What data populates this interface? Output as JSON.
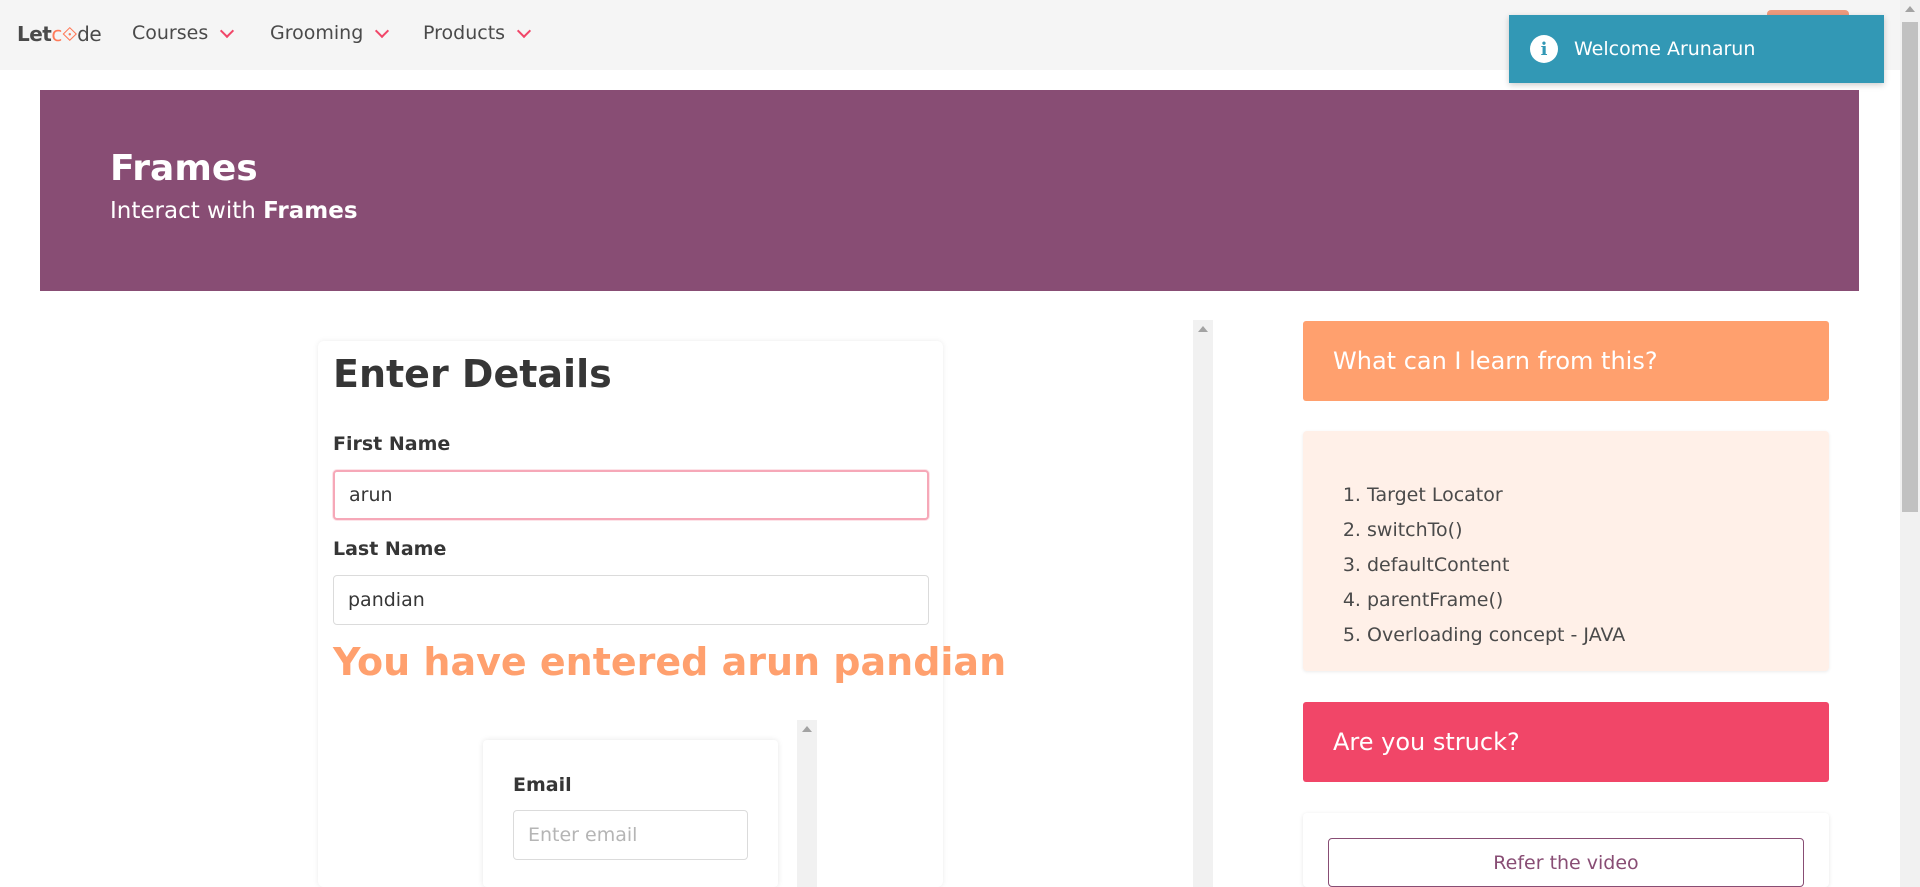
{
  "navbar": {
    "logo": {
      "part1": "Let",
      "part2": "c",
      "part3": "de"
    },
    "items": [
      {
        "label": "Courses"
      },
      {
        "label": "Grooming"
      },
      {
        "label": "Products"
      }
    ]
  },
  "toast": {
    "message": "Welcome Arunarun"
  },
  "hero": {
    "title": "Frames",
    "subtitle_prefix": "Interact with ",
    "subtitle_bold": "Frames"
  },
  "frame": {
    "heading": "Enter Details",
    "first_name_label": "First Name",
    "first_name_value": "arun",
    "last_name_label": "Last Name",
    "last_name_value": "pandian",
    "entered_text": "You have entered arun pandian",
    "inner": {
      "email_label": "Email",
      "email_placeholder": "Enter email"
    }
  },
  "sidebar": {
    "learn_title": "What can I learn from this?",
    "learn_items": [
      "Target Locator",
      "switchTo()",
      "defaultContent",
      "parentFrame()",
      "Overloading concept - JAVA"
    ],
    "struck_title": "Are you struck?",
    "video_button": "Refer the video"
  },
  "colors": {
    "hero": "#884d74",
    "accent_orange": "#ffa06e",
    "accent_red": "#f14668",
    "toast": "#3298b5"
  }
}
